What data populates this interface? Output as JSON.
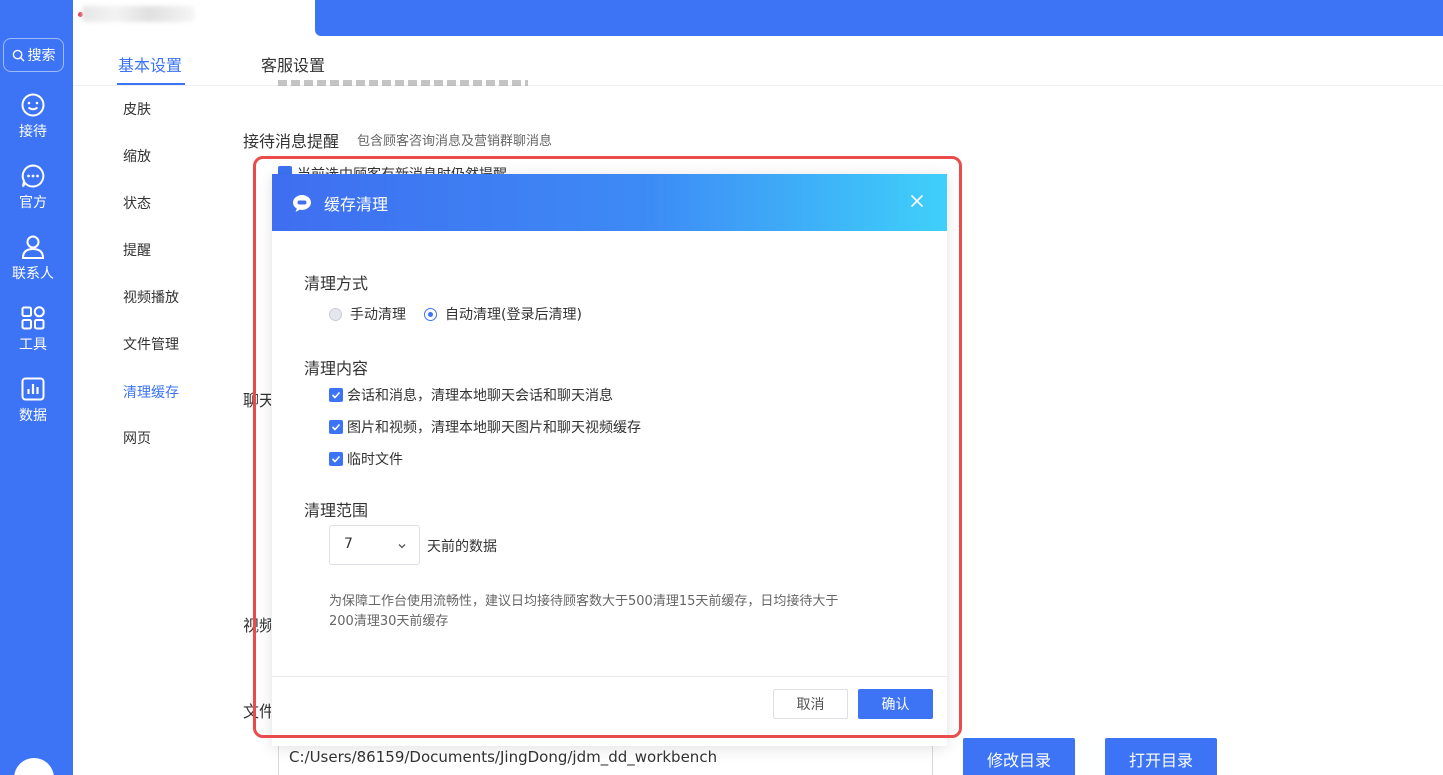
{
  "window": {
    "title": ""
  },
  "sidebar": {
    "search_label": "搜索",
    "items": [
      {
        "label": "接待",
        "icon": "smile-chat-icon"
      },
      {
        "label": "官方",
        "icon": "chat-bubble-icon"
      },
      {
        "label": "联系人",
        "icon": "person-icon"
      },
      {
        "label": "工具",
        "icon": "apps-grid-icon"
      },
      {
        "label": "数据",
        "icon": "bar-chart-icon"
      }
    ]
  },
  "settings": {
    "tabs": [
      {
        "label": "基本设置",
        "active": true
      },
      {
        "label": "客服设置",
        "active": false
      }
    ],
    "menu": [
      {
        "label": "皮肤"
      },
      {
        "label": "缩放"
      },
      {
        "label": "状态"
      },
      {
        "label": "提醒"
      },
      {
        "label": "视频播放"
      },
      {
        "label": "文件管理"
      },
      {
        "label": "清理缓存",
        "active": true
      },
      {
        "label": "网页"
      }
    ],
    "reception": {
      "title": "接待消息提醒",
      "desc": "包含顾客咨询消息及营销群聊消息",
      "checkbox_label": "当前选中顾客有新消息时仍然提醒"
    },
    "clipped_sections": [
      "聊天",
      "视频",
      "文件"
    ],
    "file_path": "C:/Users/86159/Documents/JingDong/jdm_dd_workbench",
    "modify_dir_label": "修改目录",
    "open_dir_label": "打开目录"
  },
  "dialog": {
    "title": "缓存清理",
    "method": {
      "heading": "清理方式",
      "options": [
        {
          "label": "手动清理",
          "selected": false
        },
        {
          "label": "自动清理(登录后清理)",
          "selected": true
        }
      ]
    },
    "content": {
      "heading": "清理内容",
      "items": [
        {
          "label": "会话和消息，清理本地聊天会话和聊天消息",
          "checked": true
        },
        {
          "label": "图片和视频，清理本地聊天图片和聊天视频缓存",
          "checked": true
        },
        {
          "label": "临时文件",
          "checked": true
        }
      ]
    },
    "range": {
      "heading": "清理范围",
      "selected_value": "7",
      "suffix": "天前的数据"
    },
    "tip_line1": "为保障工作台使用流畅性，建议日均接待顾客数大于500清理15天前缓存，日均接待大于",
    "tip_line2": "200清理30天前缓存",
    "cancel_label": "取消",
    "confirm_label": "确认"
  },
  "colors": {
    "brand": "#3d74f5",
    "highlight": "#ea4b4b"
  }
}
